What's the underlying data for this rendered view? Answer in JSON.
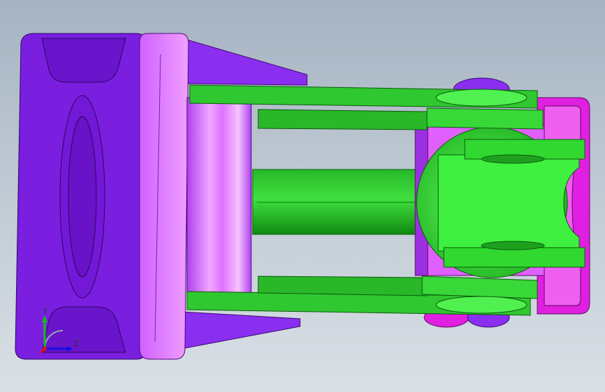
{
  "viewport": {
    "background_top": "#a6b3c1",
    "background_bottom": "#d9dfe5"
  },
  "model": {
    "part_colors": {
      "purple": "#7a1fe0",
      "purple_dark": "#5a10b0",
      "magenta": "#e070ff",
      "magenta_light": "#f0a8ff",
      "pink": "#e020e0",
      "green": "#20c020",
      "green_dark": "#0e7a0e",
      "green_light": "#60ff60"
    }
  },
  "triad": {
    "y_label": "Y",
    "z_label": "Z",
    "x_color": "#e01010",
    "y_color": "#10c010",
    "z_color": "#1010e0"
  }
}
